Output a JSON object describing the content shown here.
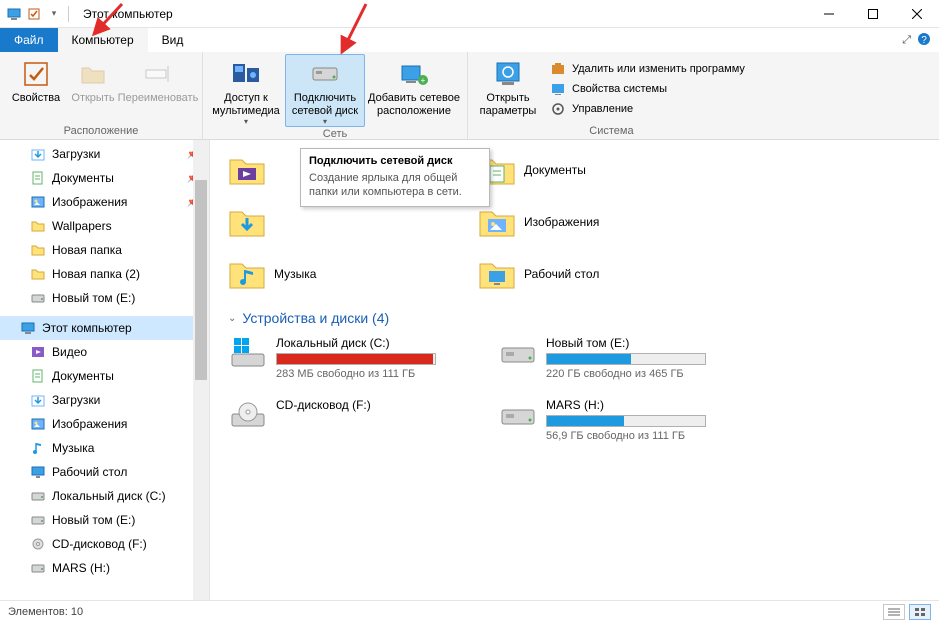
{
  "window": {
    "title": "Этот компьютер"
  },
  "menu": {
    "file": "Файл",
    "computer": "Компьютер",
    "view": "Вид"
  },
  "ribbon": {
    "location_group": "Расположение",
    "network_group": "Сеть",
    "system_group": "Система",
    "properties": "Свойства",
    "open": "Открыть",
    "rename": "Переименовать",
    "media_access": "Доступ к мультимедиа",
    "map_drive": "Подключить сетевой диск",
    "add_net_location": "Добавить сетевое расположение",
    "open_params": "Открыть параметры",
    "remove_program": "Удалить или изменить программу",
    "system_props": "Свойства системы",
    "manage": "Управление"
  },
  "tooltip": {
    "title": "Подключить сетевой диск",
    "body": "Создание ярлыка для общей папки или компьютера в сети."
  },
  "nav": {
    "items": [
      {
        "label": "Загрузки",
        "icon": "download-icon",
        "pinned": true
      },
      {
        "label": "Документы",
        "icon": "document-icon",
        "pinned": true
      },
      {
        "label": "Изображения",
        "icon": "pictures-icon",
        "pinned": true
      },
      {
        "label": "Wallpapers",
        "icon": "folder-icon"
      },
      {
        "label": "Новая папка",
        "icon": "folder-icon"
      },
      {
        "label": "Новая папка (2)",
        "icon": "folder-icon"
      },
      {
        "label": "Новый том (E:)",
        "icon": "drive-icon"
      },
      {
        "label": "Этот компьютер",
        "icon": "computer-icon",
        "selected": true,
        "level0": true
      },
      {
        "label": "Видео",
        "icon": "video-icon"
      },
      {
        "label": "Документы",
        "icon": "document-icon"
      },
      {
        "label": "Загрузки",
        "icon": "download-icon"
      },
      {
        "label": "Изображения",
        "icon": "pictures-icon"
      },
      {
        "label": "Музыка",
        "icon": "music-icon"
      },
      {
        "label": "Рабочий стол",
        "icon": "desktop-icon"
      },
      {
        "label": "Локальный диск (C:)",
        "icon": "drive-icon"
      },
      {
        "label": "Новый том (E:)",
        "icon": "drive-icon"
      },
      {
        "label": "CD-дисковод (F:)",
        "icon": "optical-icon"
      },
      {
        "label": "MARS (H:)",
        "icon": "drive-icon"
      }
    ]
  },
  "folders": [
    {
      "label": "",
      "icon": "video-folder"
    },
    {
      "label": "Документы",
      "icon": "doc-folder"
    },
    {
      "label": "",
      "icon": "download-folder"
    },
    {
      "label": "Изображения",
      "icon": "picture-folder"
    },
    {
      "label": "Музыка",
      "icon": "music-folder"
    },
    {
      "label": "Рабочий стол",
      "icon": "desktop-folder"
    }
  ],
  "section": {
    "drives_header": "Устройства и диски (4)"
  },
  "drives": [
    {
      "name": "Локальный диск (C:)",
      "status": "283 МБ свободно из 111 ГБ",
      "used_pct": 99,
      "color": "red",
      "icon": "windows-drive"
    },
    {
      "name": "Новый том (E:)",
      "status": "220 ГБ свободно из 465 ГБ",
      "used_pct": 53,
      "color": "blue",
      "icon": "hdd-drive"
    },
    {
      "name": "CD-дисковод (F:)",
      "status": "",
      "used_pct": 0,
      "color": "",
      "icon": "optical-drive"
    },
    {
      "name": "MARS (H:)",
      "status": "56,9 ГБ свободно из 111 ГБ",
      "used_pct": 49,
      "color": "blue",
      "icon": "hdd-drive"
    }
  ],
  "status": {
    "elements": "Элементов: 10"
  },
  "colors": {
    "accent": "#1979ca",
    "red": "#d9291c",
    "blue_bar": "#1e9ae0",
    "arrow": "#e22b2b"
  }
}
